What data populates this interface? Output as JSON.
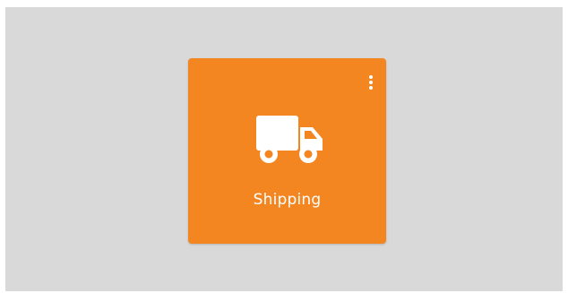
{
  "colors": {
    "page_background": "#d9d9d9",
    "tile_background": "#f38621",
    "foreground": "#ffffff"
  },
  "tile": {
    "label": "Shipping",
    "icon": "truck-icon",
    "menu_icon": "more-vertical-icon"
  }
}
